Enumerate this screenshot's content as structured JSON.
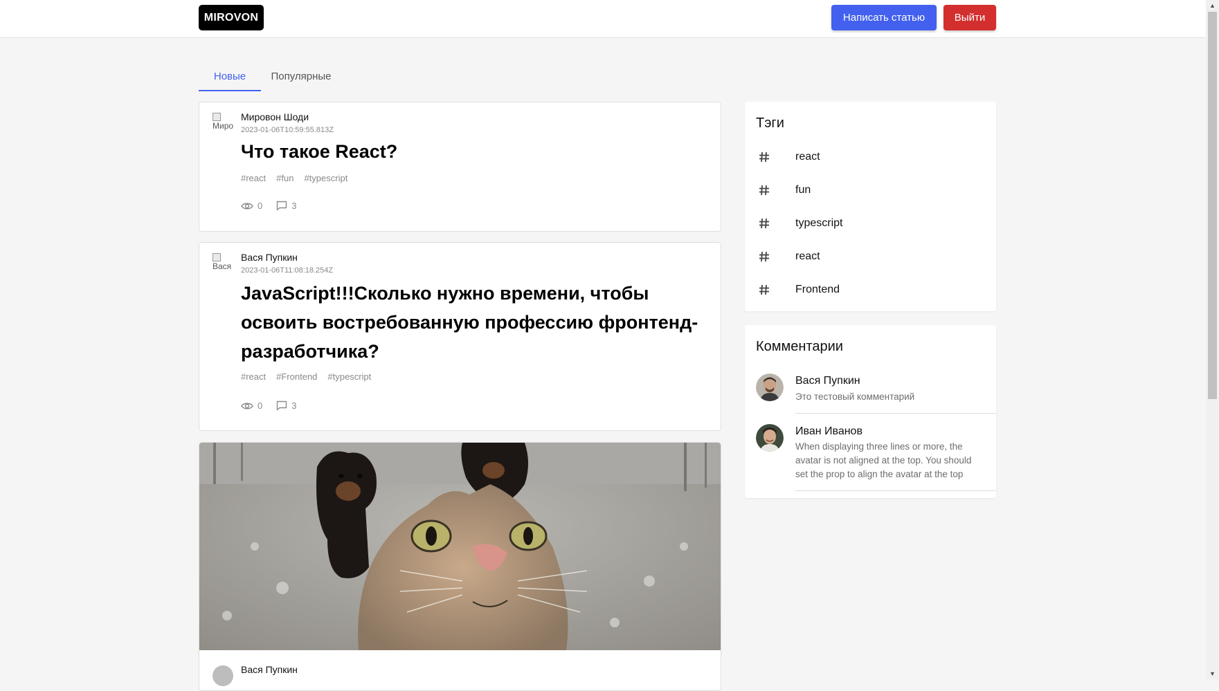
{
  "header": {
    "logo": "MIROVON",
    "write_button": "Написать статью",
    "logout_button": "Выйти"
  },
  "tabs": [
    {
      "label": "Новые",
      "active": true
    },
    {
      "label": "Популярные",
      "active": false
    }
  ],
  "posts": [
    {
      "avatar_alt": "Мировон Шоди",
      "author": "Мировон Шоди",
      "date": "2023-01-06T10:59:55.813Z",
      "title": "Что такое React?",
      "tags": [
        "#react",
        "#fun",
        "#typescript"
      ],
      "views": "0",
      "comments": "3"
    },
    {
      "avatar_alt": "Вася Пупкин",
      "author": "Вася Пупкин",
      "date": "2023-01-06T11:08:18.254Z",
      "title": "JavaScript!!!Сколько нужно времени, чтобы освоить востребованную профессию фронтенд-разработчика?",
      "tags": [
        "#react",
        "#Frontend",
        "#typescript"
      ],
      "views": "0",
      "comments": "3"
    },
    {
      "author": "Вася Пупкин",
      "image": "cat-selfie-with-rottweilers"
    }
  ],
  "sidebar": {
    "tags_title": "Тэги",
    "tags": [
      "react",
      "fun",
      "typescript",
      "react",
      "Frontend"
    ],
    "tag_icon": "hash-icon",
    "comments_title": "Комментарии",
    "comments": [
      {
        "name": "Вася Пупкин",
        "text": "Это тестовый комментарий"
      },
      {
        "name": "Иван Иванов",
        "text": "When displaying three lines or more, the avatar is not aligned at the top. You should set the prop to align the avatar at the top"
      }
    ]
  },
  "colors": {
    "primary": "#4361ee",
    "danger": "#d32f2f",
    "background": "#f5f5f5"
  }
}
